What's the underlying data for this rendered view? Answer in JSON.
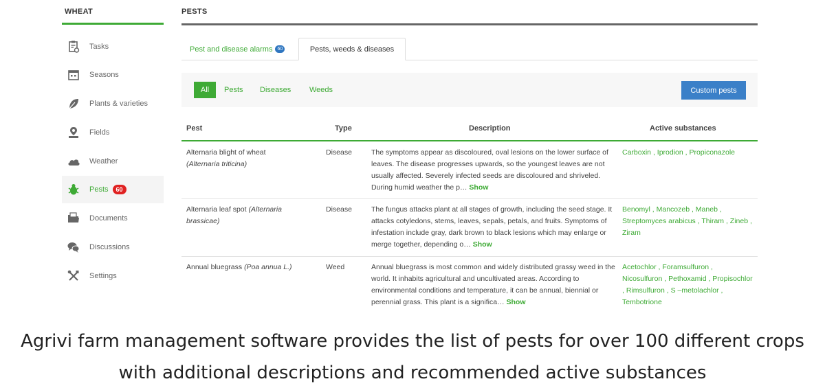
{
  "sidebar": {
    "title": "WHEAT",
    "items": [
      {
        "label": "Tasks",
        "icon": "clipboard-icon"
      },
      {
        "label": "Seasons",
        "icon": "calendar-icon"
      },
      {
        "label": "Plants & varieties",
        "icon": "leaf-icon"
      },
      {
        "label": "Fields",
        "icon": "map-pin-icon"
      },
      {
        "label": "Weather",
        "icon": "cloud-icon"
      },
      {
        "label": "Pests",
        "icon": "bug-icon",
        "badge": "60",
        "active": true
      },
      {
        "label": "Documents",
        "icon": "folder-icon"
      },
      {
        "label": "Discussions",
        "icon": "chat-icon"
      },
      {
        "label": "Settings",
        "icon": "tools-icon"
      }
    ]
  },
  "main": {
    "title": "PESTS",
    "tabs": [
      {
        "label": "Pest and disease alarms",
        "badge": "60"
      },
      {
        "label": "Pests, weeds & diseases",
        "active": true
      }
    ],
    "filters": [
      "All",
      "Pests",
      "Diseases",
      "Weeds"
    ],
    "custom_button": "Custom pests",
    "table": {
      "headers": [
        "Pest",
        "Type",
        "Description",
        "Active substances"
      ],
      "rows": [
        {
          "pest": "Alternaria blight of wheat",
          "latin": "(Alternaria triticina)",
          "type": "Disease",
          "description": "The symptoms appear as discoloured, oval lesions on the lower surface of leaves. The disease progresses upwards, so the youngest leaves are not usually affected. Severely infected seeds are discoloured and shriveled. During humid weather the p…",
          "show": "Show",
          "substances": "Carboxin , Iprodion , Propiconazole"
        },
        {
          "pest": "Alternaria leaf spot",
          "latin": "(Alternaria brassicae)",
          "type": "Disease",
          "description": "The fungus attacks plant at all stages of growth, including the seed stage. It attacks cotyledons, stems, leaves, sepals, petals, and fruits. Symptoms of infestation include gray, dark brown to black lesions which may enlarge or merge together, depending o…",
          "show": "Show",
          "substances": "Benomyl , Mancozeb , Maneb , Streptomyces arabicus , Thiram , Zineb , Ziram"
        },
        {
          "pest": "Annual bluegrass",
          "latin": "(Poa annua L.)",
          "type": "Weed",
          "description": "Annual bluegrass is most common and widely distributed grassy weed in the world. It inhabits agricultural and uncultivated areas. According to environmental conditions and temperature, it can be annual, biennial or perennial grass. This plant is a significa…",
          "show": "Show",
          "substances": "Acetochlor , Foramsulfuron , Nicosulfuron , Pethoxamid , Propisochlor , Rimsulfuron , S –metolachlor , Tembotrione"
        }
      ]
    }
  },
  "caption": {
    "line1": "Agrivi farm management software provides the list of pests for over 100 different crops",
    "line2": "with additional descriptions and recommended active substances"
  },
  "colors": {
    "accent": "#3eaa35",
    "button": "#3b80c8",
    "badge_red": "#e02222",
    "badge_blue": "#2f76c0"
  }
}
